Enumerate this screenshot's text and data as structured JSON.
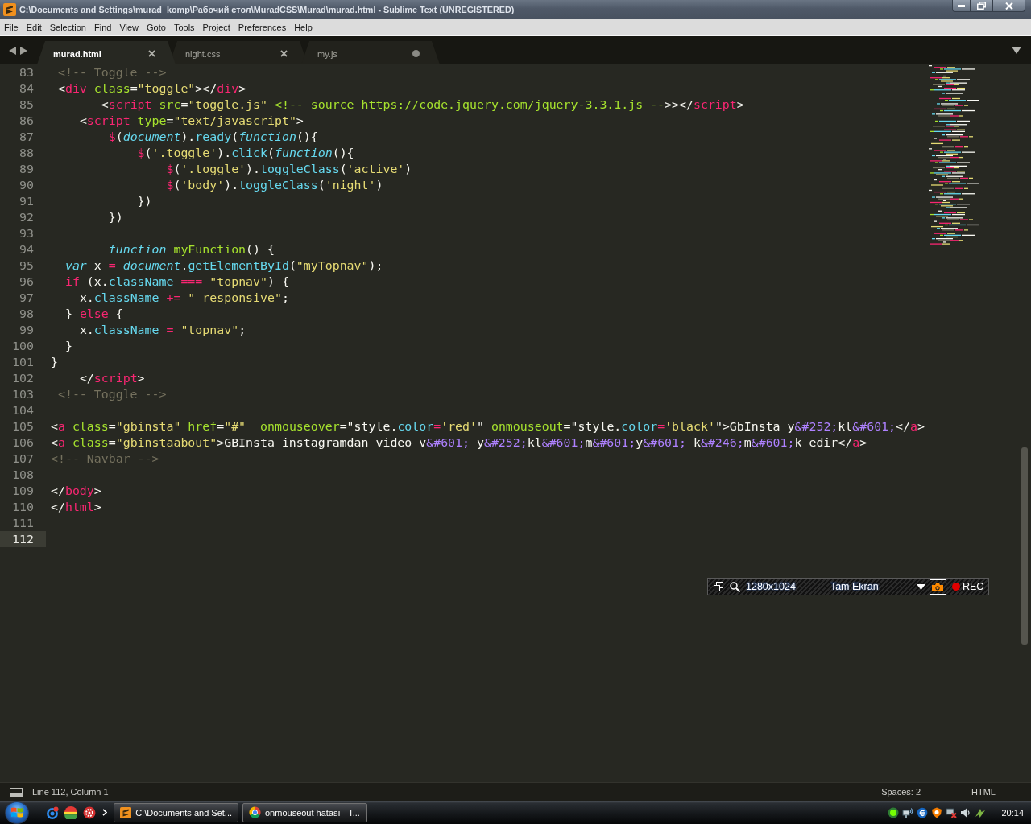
{
  "window": {
    "title": "C:\\Documents and Settings\\murad  komp\\Рабочий стол\\MuradCSS\\Murad\\murad.html - Sublime Text (UNREGISTERED)"
  },
  "menu": [
    "File",
    "Edit",
    "Selection",
    "Find",
    "View",
    "Goto",
    "Tools",
    "Project",
    "Preferences",
    "Help"
  ],
  "tabs": [
    {
      "label": "murad.html",
      "selected": true,
      "dirty": false
    },
    {
      "label": "night.css",
      "selected": false,
      "dirty": false
    },
    {
      "label": "my.js",
      "selected": false,
      "dirty": true
    }
  ],
  "editor": {
    "lines": [
      {
        "number": "83",
        "current": false,
        "tokens": [
          {
            "kind": "comment",
            "text": " <!-- Toggle -->"
          }
        ]
      },
      {
        "number": "84",
        "current": false,
        "tokens": [
          {
            "kind": "plain",
            "text": " <"
          },
          {
            "kind": "tag",
            "text": "div"
          },
          {
            "kind": "attr",
            "text": " class"
          },
          {
            "kind": "plain",
            "text": "="
          },
          {
            "kind": "string",
            "text": "\"toggle\""
          },
          {
            "kind": "plain",
            "text": "></"
          },
          {
            "kind": "tag",
            "text": "div"
          },
          {
            "kind": "plain",
            "text": ">"
          }
        ]
      },
      {
        "number": "85",
        "current": false,
        "tokens": [
          {
            "kind": "plain",
            "text": "       <"
          },
          {
            "kind": "tag",
            "text": "script"
          },
          {
            "kind": "attr",
            "text": " src"
          },
          {
            "kind": "plain",
            "text": "="
          },
          {
            "kind": "string",
            "text": "\"toggle.js\""
          },
          {
            "kind": "attr",
            "text": " <!-- source https://code.jquery.com/jquery-3.3.1.js --"
          },
          {
            "kind": "plain",
            "text": ">></"
          },
          {
            "kind": "tag",
            "text": "script"
          },
          {
            "kind": "plain",
            "text": ">"
          }
        ]
      },
      {
        "number": "86",
        "current": false,
        "tokens": [
          {
            "kind": "plain",
            "text": "    <"
          },
          {
            "kind": "tag",
            "text": "script"
          },
          {
            "kind": "attr",
            "text": " type"
          },
          {
            "kind": "plain",
            "text": "="
          },
          {
            "kind": "string",
            "text": "\"text/javascript\""
          },
          {
            "kind": "plain",
            "text": ">"
          }
        ]
      },
      {
        "number": "87",
        "current": false,
        "tokens": [
          {
            "kind": "keyword",
            "text": "        $"
          },
          {
            "kind": "plain",
            "text": "("
          },
          {
            "kind": "storage",
            "text": "document"
          },
          {
            "kind": "plain",
            "text": ")."
          },
          {
            "kind": "func",
            "text": "ready"
          },
          {
            "kind": "plain",
            "text": "("
          },
          {
            "kind": "storage",
            "text": "function"
          },
          {
            "kind": "plain",
            "text": "(){"
          }
        ]
      },
      {
        "number": "88",
        "current": false,
        "tokens": [
          {
            "kind": "keyword",
            "text": "            $"
          },
          {
            "kind": "plain",
            "text": "("
          },
          {
            "kind": "string",
            "text": "'.toggle'"
          },
          {
            "kind": "plain",
            "text": ")."
          },
          {
            "kind": "func",
            "text": "click"
          },
          {
            "kind": "plain",
            "text": "("
          },
          {
            "kind": "storage",
            "text": "function"
          },
          {
            "kind": "plain",
            "text": "(){"
          }
        ]
      },
      {
        "number": "89",
        "current": false,
        "tokens": [
          {
            "kind": "keyword",
            "text": "                $"
          },
          {
            "kind": "plain",
            "text": "("
          },
          {
            "kind": "string",
            "text": "'.toggle'"
          },
          {
            "kind": "plain",
            "text": ")."
          },
          {
            "kind": "func",
            "text": "toggleClass"
          },
          {
            "kind": "plain",
            "text": "("
          },
          {
            "kind": "string",
            "text": "'active'"
          },
          {
            "kind": "plain",
            "text": ")"
          }
        ]
      },
      {
        "number": "90",
        "current": false,
        "tokens": [
          {
            "kind": "keyword",
            "text": "                $"
          },
          {
            "kind": "plain",
            "text": "("
          },
          {
            "kind": "string",
            "text": "'body'"
          },
          {
            "kind": "plain",
            "text": ")."
          },
          {
            "kind": "func",
            "text": "toggleClass"
          },
          {
            "kind": "plain",
            "text": "("
          },
          {
            "kind": "string",
            "text": "'night'"
          },
          {
            "kind": "plain",
            "text": ")"
          }
        ]
      },
      {
        "number": "91",
        "current": false,
        "tokens": [
          {
            "kind": "plain",
            "text": "            })"
          }
        ]
      },
      {
        "number": "92",
        "current": false,
        "tokens": [
          {
            "kind": "plain",
            "text": "        })"
          }
        ]
      },
      {
        "number": "93",
        "current": false
      },
      {
        "number": "94",
        "current": false,
        "tokens": [
          {
            "kind": "storage",
            "text": "        function"
          },
          {
            "kind": "name",
            "text": " myFunction"
          },
          {
            "kind": "plain",
            "text": "() {"
          }
        ]
      },
      {
        "number": "95",
        "current": false,
        "tokens": [
          {
            "kind": "storage",
            "text": "  var"
          },
          {
            "kind": "plain",
            "text": " x "
          },
          {
            "kind": "keyword",
            "text": "="
          },
          {
            "kind": "storage",
            "text": " document"
          },
          {
            "kind": "plain",
            "text": "."
          },
          {
            "kind": "func",
            "text": "getElementById"
          },
          {
            "kind": "plain",
            "text": "("
          },
          {
            "kind": "string",
            "text": "\"myTopnav\""
          },
          {
            "kind": "plain",
            "text": ");"
          }
        ]
      },
      {
        "number": "96",
        "current": false,
        "tokens": [
          {
            "kind": "keyword",
            "text": "  if"
          },
          {
            "kind": "plain",
            "text": " (x."
          },
          {
            "kind": "func",
            "text": "className"
          },
          {
            "kind": "keyword",
            "text": " ==="
          },
          {
            "kind": "string",
            "text": " \"topnav\""
          },
          {
            "kind": "plain",
            "text": ") {"
          }
        ]
      },
      {
        "number": "97",
        "current": false,
        "tokens": [
          {
            "kind": "plain",
            "text": "    x."
          },
          {
            "kind": "func",
            "text": "className"
          },
          {
            "kind": "keyword",
            "text": " +="
          },
          {
            "kind": "string",
            "text": " \" responsive\""
          },
          {
            "kind": "plain",
            "text": ";"
          }
        ]
      },
      {
        "number": "98",
        "current": false,
        "tokens": [
          {
            "kind": "plain",
            "text": "  } "
          },
          {
            "kind": "keyword",
            "text": "else"
          },
          {
            "kind": "plain",
            "text": " {"
          }
        ]
      },
      {
        "number": "99",
        "current": false,
        "tokens": [
          {
            "kind": "plain",
            "text": "    x."
          },
          {
            "kind": "func",
            "text": "className"
          },
          {
            "kind": "keyword",
            "text": " ="
          },
          {
            "kind": "string",
            "text": " \"topnav\""
          },
          {
            "kind": "plain",
            "text": ";"
          }
        ]
      },
      {
        "number": "100",
        "current": false,
        "tokens": [
          {
            "kind": "plain",
            "text": "  }"
          }
        ]
      },
      {
        "number": "101",
        "current": false,
        "tokens": [
          {
            "kind": "plain",
            "text": "}"
          }
        ]
      },
      {
        "number": "102",
        "current": false,
        "tokens": [
          {
            "kind": "plain",
            "text": "    </"
          },
          {
            "kind": "tag",
            "text": "script"
          },
          {
            "kind": "plain",
            "text": ">"
          }
        ]
      },
      {
        "number": "103",
        "current": false,
        "tokens": [
          {
            "kind": "comment",
            "text": " <!-- Toggle -->"
          }
        ]
      },
      {
        "number": "104",
        "current": false
      },
      {
        "number": "105",
        "current": false,
        "tokens": [
          {
            "kind": "plain",
            "text": "<"
          },
          {
            "kind": "tag",
            "text": "a"
          },
          {
            "kind": "attr",
            "text": " class"
          },
          {
            "kind": "plain",
            "text": "="
          },
          {
            "kind": "string",
            "text": "\"gbinsta\""
          },
          {
            "kind": "attr",
            "text": " href"
          },
          {
            "kind": "plain",
            "text": "="
          },
          {
            "kind": "string",
            "text": "\"#\""
          },
          {
            "kind": "attr",
            "text": "  onmouseover"
          },
          {
            "kind": "plain",
            "text": "=\"style."
          },
          {
            "kind": "func",
            "text": "color"
          },
          {
            "kind": "keyword",
            "text": "="
          },
          {
            "kind": "string",
            "text": "'red'"
          },
          {
            "kind": "plain",
            "text": "\""
          },
          {
            "kind": "attr",
            "text": " onmouseout"
          },
          {
            "kind": "plain",
            "text": "=\"style."
          },
          {
            "kind": "func",
            "text": "color"
          },
          {
            "kind": "keyword",
            "text": "="
          },
          {
            "kind": "string",
            "text": "'black'"
          },
          {
            "kind": "plain",
            "text": "\">GbInsta y"
          },
          {
            "kind": "entity",
            "text": "&#252;"
          },
          {
            "kind": "plain",
            "text": "kl"
          },
          {
            "kind": "entity",
            "text": "&#601;"
          },
          {
            "kind": "plain",
            "text": "</"
          },
          {
            "kind": "tag",
            "text": "a"
          },
          {
            "kind": "plain",
            "text": ">"
          }
        ]
      },
      {
        "number": "106",
        "current": false,
        "tokens": [
          {
            "kind": "plain",
            "text": "<"
          },
          {
            "kind": "tag",
            "text": "a"
          },
          {
            "kind": "attr",
            "text": " class"
          },
          {
            "kind": "plain",
            "text": "="
          },
          {
            "kind": "string",
            "text": "\"gbinstaabout\""
          },
          {
            "kind": "plain",
            "text": ">GBInsta instagramdan video v"
          },
          {
            "kind": "entity",
            "text": "&#601;"
          },
          {
            "kind": "plain",
            "text": " y"
          },
          {
            "kind": "entity",
            "text": "&#252;"
          },
          {
            "kind": "plain",
            "text": "kl"
          },
          {
            "kind": "entity",
            "text": "&#601;"
          },
          {
            "kind": "plain",
            "text": "m"
          },
          {
            "kind": "entity",
            "text": "&#601;"
          },
          {
            "kind": "plain",
            "text": "y"
          },
          {
            "kind": "entity",
            "text": "&#601;"
          },
          {
            "kind": "plain",
            "text": " k"
          },
          {
            "kind": "entity",
            "text": "&#246;"
          },
          {
            "kind": "plain",
            "text": "m"
          },
          {
            "kind": "entity",
            "text": "&#601;"
          },
          {
            "kind": "plain",
            "text": "k edir</"
          },
          {
            "kind": "tag",
            "text": "a"
          },
          {
            "kind": "plain",
            "text": ">"
          }
        ]
      },
      {
        "number": "107",
        "current": false,
        "tokens": [
          {
            "kind": "comment",
            "text": "<!-- Navbar -->"
          }
        ]
      },
      {
        "number": "108",
        "current": false
      },
      {
        "number": "109",
        "current": false,
        "tokens": [
          {
            "kind": "plain",
            "text": "</"
          },
          {
            "kind": "tag",
            "text": "body"
          },
          {
            "kind": "plain",
            "text": ">"
          }
        ]
      },
      {
        "number": "110",
        "current": false,
        "tokens": [
          {
            "kind": "plain",
            "text": "</"
          },
          {
            "kind": "tag",
            "text": "html"
          },
          {
            "kind": "plain",
            "text": ">"
          }
        ]
      },
      {
        "number": "111",
        "current": false
      },
      {
        "number": "112",
        "current": true
      }
    ]
  },
  "recorder": {
    "resolution": "1280x1024",
    "mode": "Tam Ekran",
    "record_label": "REC"
  },
  "status_bar": {
    "position": "Line 112, Column 1",
    "indentation": "Spaces: 2",
    "syntax": "HTML"
  },
  "taskbar": {
    "tasks": [
      {
        "kind": "editor",
        "label": "C:\\Documents and Set..."
      },
      {
        "kind": "browser",
        "label": "onmouseout hatası - T..."
      }
    ],
    "clock": "20:14"
  }
}
